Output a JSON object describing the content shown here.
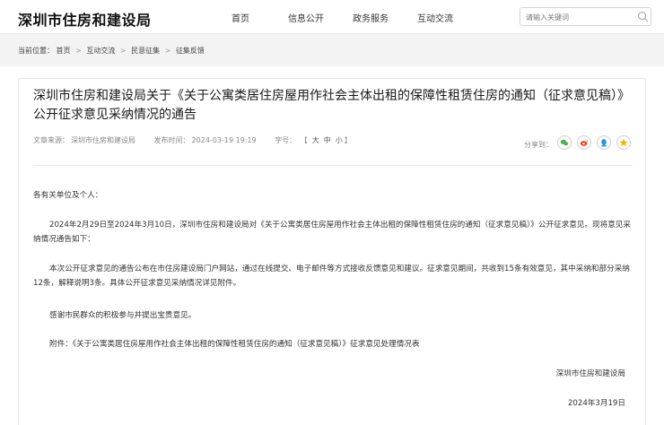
{
  "header": {
    "logo": "深圳市住房和建设局",
    "nav": [
      "首页",
      "信息公开",
      "政务服务",
      "互动交流"
    ],
    "search_placeholder": "请输入关键词"
  },
  "breadcrumb": {
    "prefix": "当前位置：",
    "items": [
      "首页",
      "互动交流",
      "民意征集",
      "征集反馈"
    ],
    "separator": ">"
  },
  "article": {
    "title": "深圳市住房和建设局关于《关于公寓类居住房屋用作社会主体出租的保障性租赁住房的通知（征求意见稿）》公开征求意见采纳情况的通告",
    "source_label": "文章来源：",
    "source": "深圳市住房和建设局",
    "time_label": "发布时间：",
    "time": "2024-03-19 19:19",
    "font_label": "字号：",
    "font_open": "【",
    "font_sizes": [
      "大",
      "中",
      "小"
    ],
    "font_close": "】",
    "share_label": "分享到：",
    "share_icons": [
      "wechat-icon",
      "weibo-icon",
      "qq-icon",
      "qzone-icon"
    ],
    "greeting": "各有关单位及个人：",
    "paragraphs": [
      "2024年2月29日至2024年3月10日，深圳市住房和建设局对《关于公寓类居住房屋用作社会主体出租的保障性租赁住房的通知（征求意见稿）》公开征求意见。现将意见采纳情况通告如下：",
      "本次公开征求意见的通告公布在市住房建设局门户网站，通过在线提交、电子邮件等方式接收反馈意见和建议。征求意见期间，共收到15条有效意见，其中采纳和部分采纳12条，解释说明3条。具体公开征求意见采纳情况详见附件。",
      "感谢市民群众的积极参与并提出宝贵意见。",
      "附件：《关于公寓类居住房屋用作社会主体出租的保障性租赁住房的通知（征求意见稿）》征求意见处理情况表"
    ],
    "signature": "深圳市住房和建设局",
    "date": "2024年3月19日"
  }
}
